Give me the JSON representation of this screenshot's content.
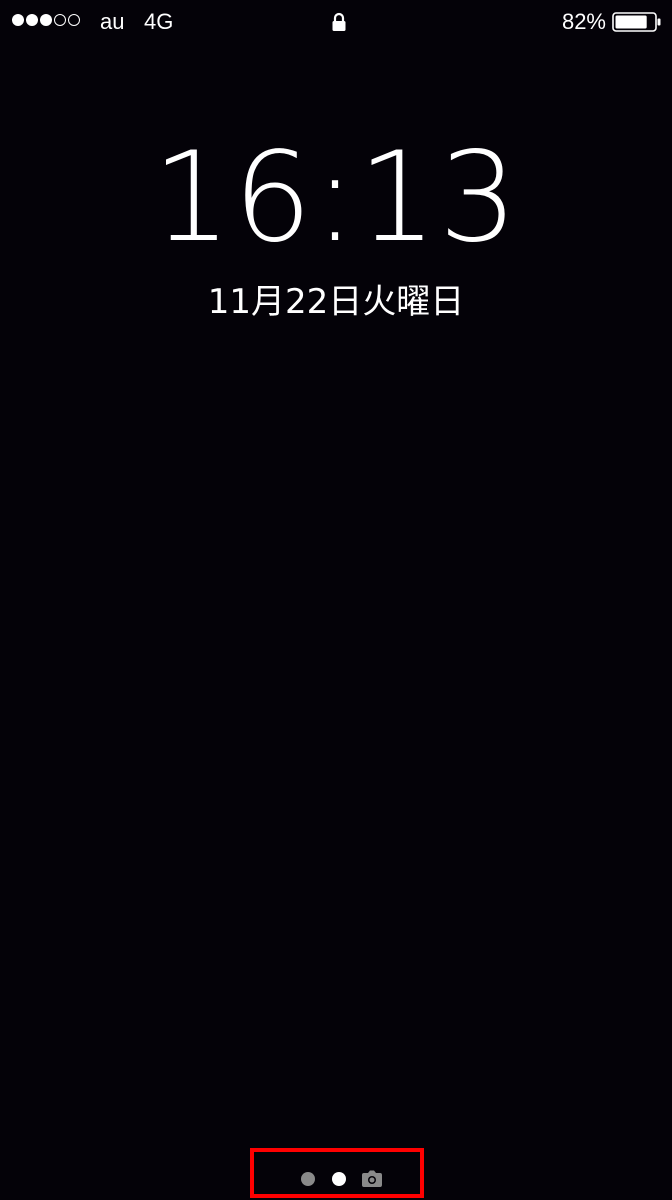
{
  "status_bar": {
    "signal_strength": 3,
    "signal_max": 5,
    "carrier": "au",
    "network": "4G",
    "lock_icon": "lock-icon",
    "battery_percent": "82%",
    "battery_level": 0.82
  },
  "lock_screen": {
    "time": "16:13",
    "date": "11月22日火曜日"
  },
  "page_indicator": {
    "pages": 2,
    "current_page": 2,
    "camera_icon": "camera-icon",
    "highlight_color": "#ff0000"
  },
  "colors": {
    "background": "#040208",
    "text": "#ffffff"
  }
}
